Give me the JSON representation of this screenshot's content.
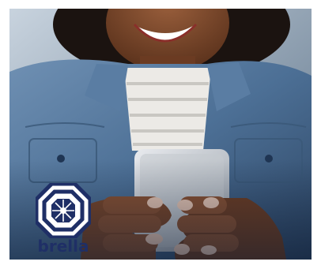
{
  "photo": {
    "description_icon": "person-holding-smartphone-photo"
  },
  "brand": {
    "name": "brella",
    "logo_icon": "brella-octagon-umbrella-logo",
    "logo_color": "#1f2f66"
  }
}
